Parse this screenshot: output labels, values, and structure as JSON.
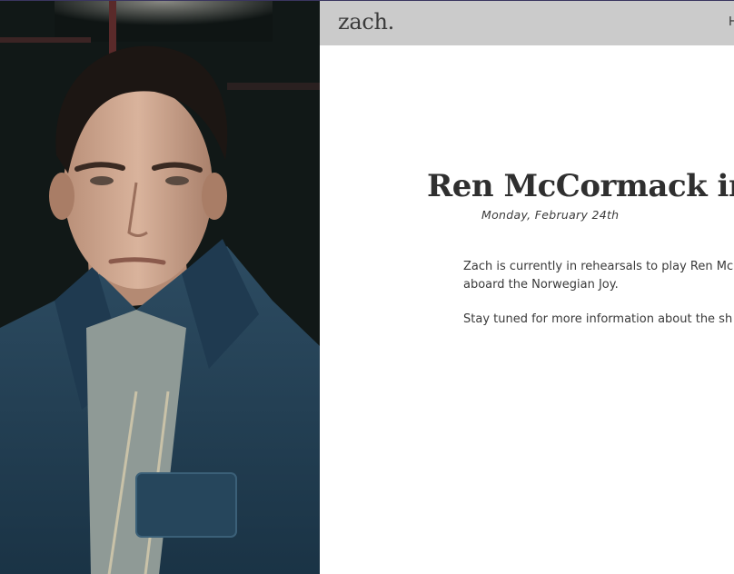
{
  "header": {
    "logo": "zach.",
    "nav_link": "H"
  },
  "post": {
    "title": "Ren McCormack in",
    "date": "Monday, February 24th",
    "paragraphs": [
      "Zach is currently in rehearsals to play Ren Mc",
      "aboard the Norwegian Joy.",
      "Stay tuned for more information about the sh"
    ]
  },
  "colors": {
    "navbar": "#cbcbcb",
    "text": "#333333",
    "background": "#ffffff"
  }
}
